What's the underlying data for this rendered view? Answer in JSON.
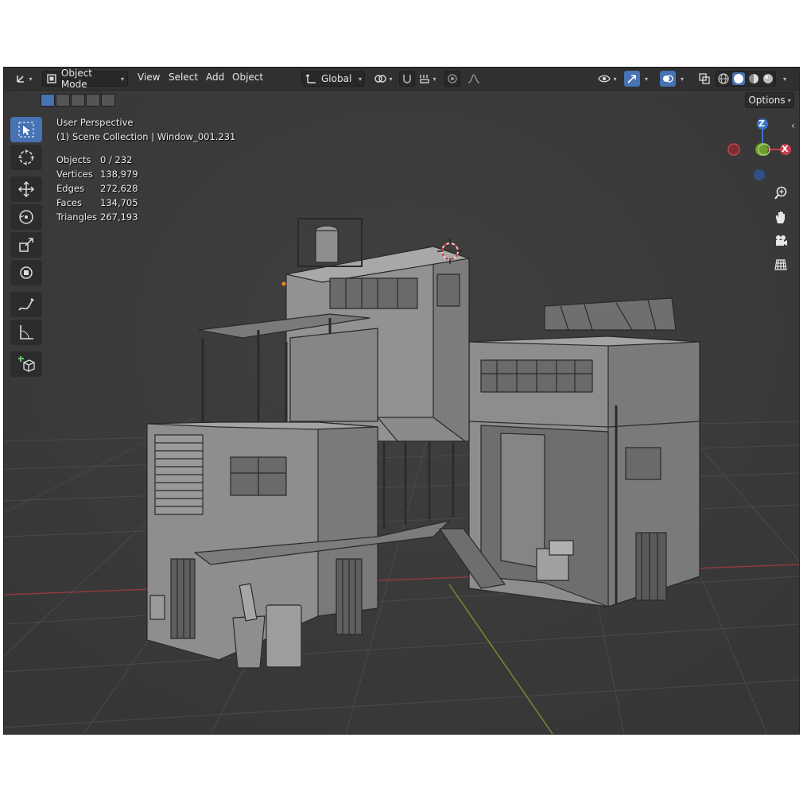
{
  "header": {
    "mode_label": "Object Mode",
    "menus": [
      "View",
      "Select",
      "Add",
      "Object"
    ],
    "transform_orientation": "Global",
    "options_label": "Options"
  },
  "viewport": {
    "perspective_label": "User Perspective",
    "collection_label": "(1) Scene Collection | Window_001.231",
    "stats": [
      {
        "label": "Objects",
        "value": "0 / 232"
      },
      {
        "label": "Vertices",
        "value": "138,979"
      },
      {
        "label": "Edges",
        "value": "272,628"
      },
      {
        "label": "Faces",
        "value": "134,705"
      },
      {
        "label": "Triangles",
        "value": "267,193"
      }
    ]
  },
  "gizmo": {
    "z": "Z",
    "x": "X"
  },
  "colors": {
    "accent": "#4772b3",
    "x_axis": "#c9414d",
    "y_axis": "#6c9e2f",
    "z_axis": "#3a74c9"
  },
  "toolbar_icons": [
    "select-box-icon",
    "cursor-icon",
    "move-icon",
    "rotate-icon",
    "scale-icon",
    "transform-icon",
    "annotate-icon",
    "measure-icon",
    "add-cube-icon"
  ],
  "nav_icons": [
    "zoom-icon",
    "hand-pan-icon",
    "camera-icon",
    "grid-ortho-icon"
  ]
}
